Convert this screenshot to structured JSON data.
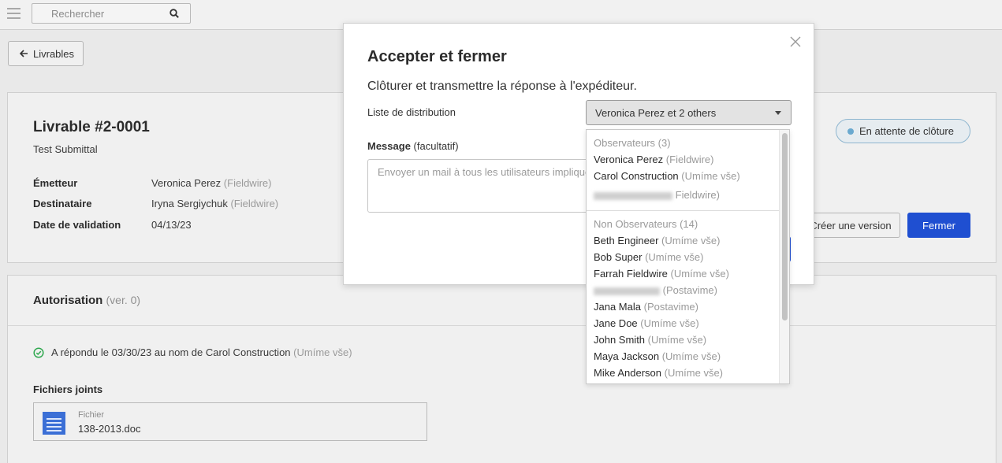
{
  "topbar": {
    "search_placeholder": "Rechercher"
  },
  "nav": {
    "back_label": "Livrables"
  },
  "submittal": {
    "title": "Livrable #2-0001",
    "subtitle": "Test Submittal",
    "fields": [
      {
        "key": "Émetteur",
        "value": "Veronica Perez",
        "org": "(Fieldwire)"
      },
      {
        "key": "Destinataire",
        "value": "Iryna Sergiychuk",
        "org": "(Fieldwire)"
      },
      {
        "key": "Date de validation",
        "value": "04/13/23",
        "org": ""
      }
    ],
    "status": "En attente de clôture",
    "version_button": "Créer une version",
    "close_button": "Fermer"
  },
  "authorization": {
    "title": "Autorisation",
    "version": "(ver. 0)",
    "reply_text": "A répondu le 03/30/23 au nom de Carol Construction",
    "reply_org": "(Umíme vše)",
    "files_title": "Fichiers joints",
    "file_label": "Fichier",
    "file_name": "138-2013.doc"
  },
  "modal": {
    "title": "Accepter et fermer",
    "description": "Clôturer et transmettre la réponse à l'expéditeur.",
    "distribution_label": "Liste de distribution",
    "distribution_value": "Veronica Perez et 2 others",
    "message_label": "Message",
    "message_optional": "(facultatif)",
    "message_placeholder": "Envoyer un mail à tous les utilisateurs impliqués"
  },
  "dropdown": {
    "observers_header": "Observateurs (3)",
    "observers": [
      {
        "name": "Veronica Perez",
        "org": "(Fieldwire)"
      },
      {
        "name": "Carol Construction",
        "org": "(Umíme vše)"
      },
      {
        "name": "",
        "org": "Fieldwire)"
      }
    ],
    "non_observers_header": "Non Observateurs (14)",
    "non_observers": [
      {
        "name": "Beth Engineer",
        "org": "(Umíme vše)"
      },
      {
        "name": "Bob Super",
        "org": "(Umíme vše)"
      },
      {
        "name": "Farrah Fieldwire",
        "org": "(Umíme vše)"
      },
      {
        "name": "",
        "org": "(Postavime)"
      },
      {
        "name": "Jana Mala",
        "org": "(Postavime)"
      },
      {
        "name": "Jane Doe",
        "org": "(Umíme vše)"
      },
      {
        "name": "John Smith",
        "org": "(Umíme vše)"
      },
      {
        "name": "Maya Jackson",
        "org": "(Umíme vše)"
      },
      {
        "name": "Mike Anderson",
        "org": "(Umíme vše)"
      }
    ]
  },
  "colors": {
    "primary": "#1f4fd1",
    "status_dot": "#6aa9cf",
    "success": "#2fa84f"
  }
}
